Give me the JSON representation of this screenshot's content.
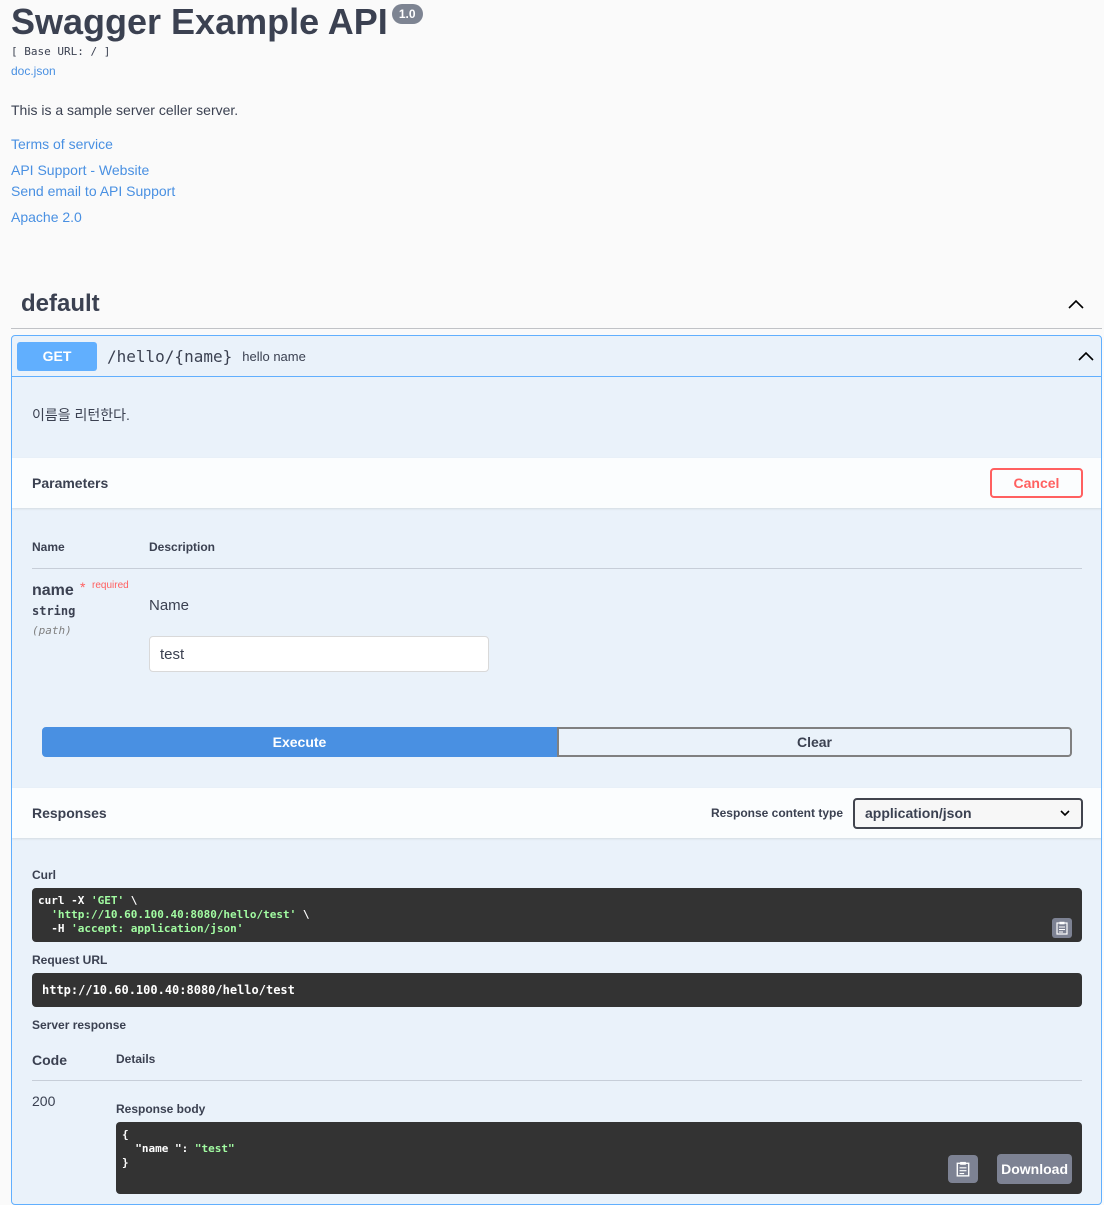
{
  "info": {
    "title": "Swagger Example API",
    "version": "1.0",
    "base_url": "[ Base URL: / ]",
    "doc_link": "doc.json",
    "description": "This is a sample server celler server.",
    "terms": "Terms of service",
    "support_website": "API Support - Website",
    "support_email": "Send email to API Support",
    "license": "Apache 2.0"
  },
  "tag": {
    "name": "default"
  },
  "operation": {
    "method": "GET",
    "path": "/hello/{name}",
    "summary": "hello name",
    "description": "이름을 리턴한다.",
    "parameters_title": "Parameters",
    "cancel_label": "Cancel",
    "col_name": "Name",
    "col_description": "Description",
    "param": {
      "name": "name",
      "star": "*",
      "required": "required",
      "type": "string",
      "in": "(path)",
      "description": "Name",
      "value": "test"
    },
    "execute_label": "Execute",
    "clear_label": "Clear"
  },
  "responses": {
    "title": "Responses",
    "content_type_label": "Response content type",
    "content_type_value": "application/json",
    "curl_label": "Curl",
    "curl_lines": [
      {
        "pre": "curl -X ",
        "str": "'GET'",
        "post": " \\"
      },
      {
        "pre": "  ",
        "str": "'http://10.60.100.40:8080/hello/test'",
        "post": " \\"
      },
      {
        "pre": "  -H ",
        "str": "'accept: application/json'",
        "post": ""
      }
    ],
    "request_url_label": "Request URL",
    "request_url": "http://10.60.100.40:8080/hello/test",
    "server_response_label": "Server response",
    "code_header": "Code",
    "details_header": "Details",
    "code": "200",
    "body_label": "Response body",
    "body_line1": "{",
    "body_key": "  \"name \": ",
    "body_val": "\"test\"",
    "body_line3": "}",
    "download_label": "Download"
  }
}
